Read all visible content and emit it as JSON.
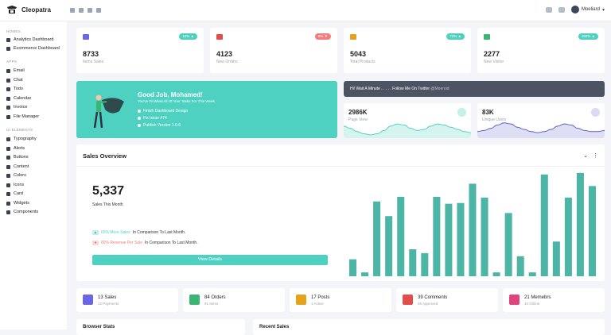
{
  "app": {
    "title": "Cleopatra"
  },
  "header": {
    "user_name": "Moeliard"
  },
  "sidebar": {
    "sections": [
      {
        "title": "HOMES",
        "items": [
          "Analytics Dashboard",
          "Ecommerce Dashboard"
        ]
      },
      {
        "title": "APPS",
        "items": [
          "Email",
          "Chat",
          "Todo",
          "Calendar",
          "Invoice",
          "File Manager"
        ]
      },
      {
        "title": "UI ELEMENTS",
        "items": [
          "Typography",
          "Alerts",
          "Buttons",
          "Content",
          "Colors",
          "Icons",
          "Card",
          "Widgets",
          "Components"
        ]
      }
    ]
  },
  "stats": [
    {
      "value": "8733",
      "label": "Items Sales",
      "badge": "12% ▲",
      "badge_color": "#4fd1c2",
      "icon": "cart-icon",
      "icon_color": "#6b66e5"
    },
    {
      "value": "4123",
      "label": "New Orders",
      "badge": "6% ▼",
      "badge_color": "#f47c7c",
      "icon": "store-icon",
      "icon_color": "#e24c4c"
    },
    {
      "value": "5043",
      "label": "Total Products",
      "badge": "72% ▲",
      "badge_color": "#4fd1c2",
      "icon": "boxes-icon",
      "icon_color": "#e5a319"
    },
    {
      "value": "2277",
      "label": "New Visitor",
      "badge": "150% ▲",
      "badge_color": "#4fd1c2",
      "icon": "user-icon",
      "icon_color": "#3bb573"
    }
  ],
  "welcome": {
    "title": "Good Job, Mohamed!",
    "subtitle": "You've Finished All Of Your Tasks For This Week.",
    "tasks": [
      "Finish Dashboard Design",
      "Fix Issue #74",
      "Publish Version 1.0.6"
    ]
  },
  "twitter": {
    "text": "Hi! Wait A Minute . . . . . Follow Me On Twitter",
    "handle": "@Moeroid"
  },
  "mini_stats": [
    {
      "value": "2986K",
      "label": "Page View",
      "color": "#4fd1c2",
      "values": [
        11,
        9,
        6,
        4,
        3,
        4,
        7,
        11,
        13,
        12,
        9,
        7,
        8,
        11,
        13,
        12,
        10,
        8,
        6,
        5
      ]
    },
    {
      "value": "83K",
      "label": "Unique Users",
      "color": "#5a5fc9",
      "values": [
        6,
        7,
        9,
        12,
        14,
        13,
        10,
        8,
        6,
        5,
        6,
        8,
        11,
        13,
        12,
        9,
        7,
        6,
        6,
        7
      ]
    }
  ],
  "sales": {
    "title": "Sales Overview",
    "value": "5,337",
    "label": "Sales This Month",
    "up_pct": "65% More Sales",
    "up_text": "In Comparison To Last Month.",
    "down_pct": "80% Revenue Per Sale",
    "down_text": "In Comparison To Last Month.",
    "button": "View Details"
  },
  "chart_data": {
    "type": "bar",
    "values": [
      22,
      5,
      97,
      78,
      103,
      35,
      30,
      103,
      94,
      95,
      120,
      102,
      5,
      82,
      26,
      5,
      132,
      45,
      102,
      134,
      117
    ],
    "ylim": [
      0,
      140
    ],
    "color": "#4cb5a6"
  },
  "bottom_cards": [
    {
      "value": "13 Sales",
      "label": "12 Payments",
      "color": "#6b66e5",
      "icon": "card-icon"
    },
    {
      "value": "84 Orders",
      "label": "91 Items",
      "color": "#3bb573",
      "icon": "cart-icon"
    },
    {
      "value": "17 Posts",
      "label": "1 Active",
      "color": "#e5a319",
      "icon": "post-icon"
    },
    {
      "value": "39 Comments",
      "label": "26 Approved",
      "color": "#e24c4c",
      "icon": "comment-icon"
    },
    {
      "value": "21 Memebrs",
      "label": "10 Online",
      "color": "#e0437e",
      "icon": "members-icon"
    }
  ],
  "lower_panels": [
    {
      "title": "Browser Stats"
    },
    {
      "title": "Recent Sales"
    }
  ]
}
